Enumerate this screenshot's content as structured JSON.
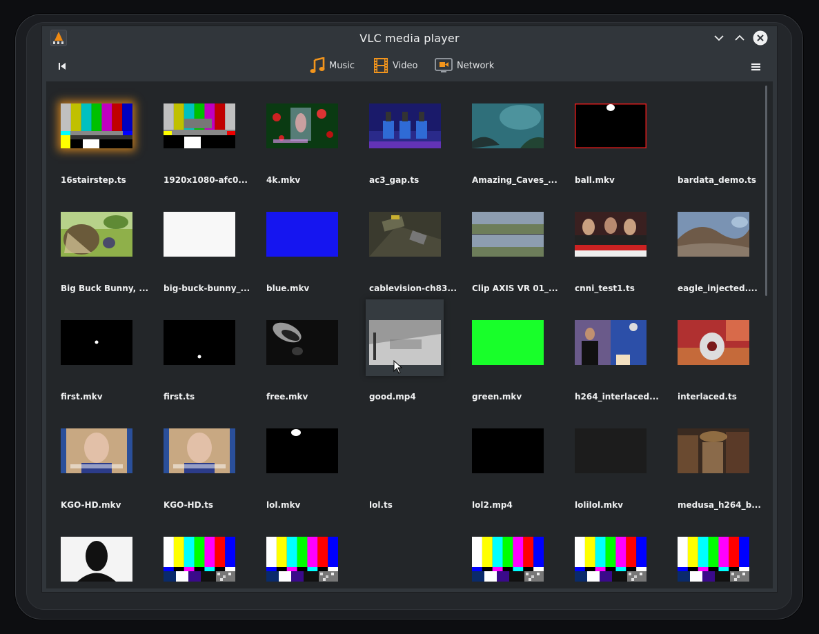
{
  "window": {
    "title": "VLC media player"
  },
  "toolbar": {
    "categories": [
      {
        "label": "Music",
        "icon": "music-note-icon"
      },
      {
        "label": "Video",
        "icon": "film-strip-icon"
      },
      {
        "label": "Network",
        "icon": "network-camera-icon"
      }
    ]
  },
  "colors": {
    "accent": "#f3951c",
    "window_bg": "#31363b",
    "content_bg": "#232629",
    "text": "#eff0f1"
  },
  "media": [
    {
      "label": "16stairstep.ts",
      "thumb": "stairstep"
    },
    {
      "label": "1920x1080-afc0...",
      "thumb": "stairstep-small"
    },
    {
      "label": "4k.mkv",
      "thumb": "green-red-card"
    },
    {
      "label": "ac3_gap.ts",
      "thumb": "gameshow"
    },
    {
      "label": "Amazing_Caves_...",
      "thumb": "cave"
    },
    {
      "label": "ball.mkv",
      "thumb": "ball-red-border"
    },
    {
      "label": "bardata_demo.ts",
      "thumb": "none"
    },
    {
      "label": "Big Buck Bunny, ...",
      "thumb": "bunny"
    },
    {
      "label": "big-buck-bunny_...",
      "thumb": "white"
    },
    {
      "label": "blue.mkv",
      "thumb": "blue"
    },
    {
      "label": "cablevision-ch83...",
      "thumb": "game-3d"
    },
    {
      "label": "Clip AXIS VR 01_...",
      "thumb": "field-stereo"
    },
    {
      "label": "cnni_test1.ts",
      "thumb": "news"
    },
    {
      "label": "eagle_injected....",
      "thumb": "panorama"
    },
    {
      "label": "first.mkv",
      "thumb": "black-dot"
    },
    {
      "label": "first.ts",
      "thumb": "black-dot-low"
    },
    {
      "label": "free.mkv",
      "thumb": "dark-object"
    },
    {
      "label": "good.mp4",
      "thumb": "old-film"
    },
    {
      "label": "green.mkv",
      "thumb": "green"
    },
    {
      "label": "h264_interlaced...",
      "thumb": "interview"
    },
    {
      "label": "interlaced.ts",
      "thumb": "robot"
    },
    {
      "label": "KGO-HD.mkv",
      "thumb": "portrait"
    },
    {
      "label": "KGO-HD.ts",
      "thumb": "portrait"
    },
    {
      "label": "lol.mkv",
      "thumb": "ball-top"
    },
    {
      "label": "lol.ts",
      "thumb": "none"
    },
    {
      "label": "lol2.mp4",
      "thumb": "black"
    },
    {
      "label": "lolilol.mkv",
      "thumb": "dark-gray"
    },
    {
      "label": "medusa_h264_b...",
      "thumb": "medusa"
    },
    {
      "label": "",
      "thumb": "silhouette"
    },
    {
      "label": "",
      "thumb": "smpte"
    },
    {
      "label": "",
      "thumb": "smpte"
    },
    {
      "label": "",
      "thumb": "none"
    },
    {
      "label": "",
      "thumb": "smpte"
    },
    {
      "label": "",
      "thumb": "smpte"
    },
    {
      "label": "",
      "thumb": "smpte"
    }
  ]
}
